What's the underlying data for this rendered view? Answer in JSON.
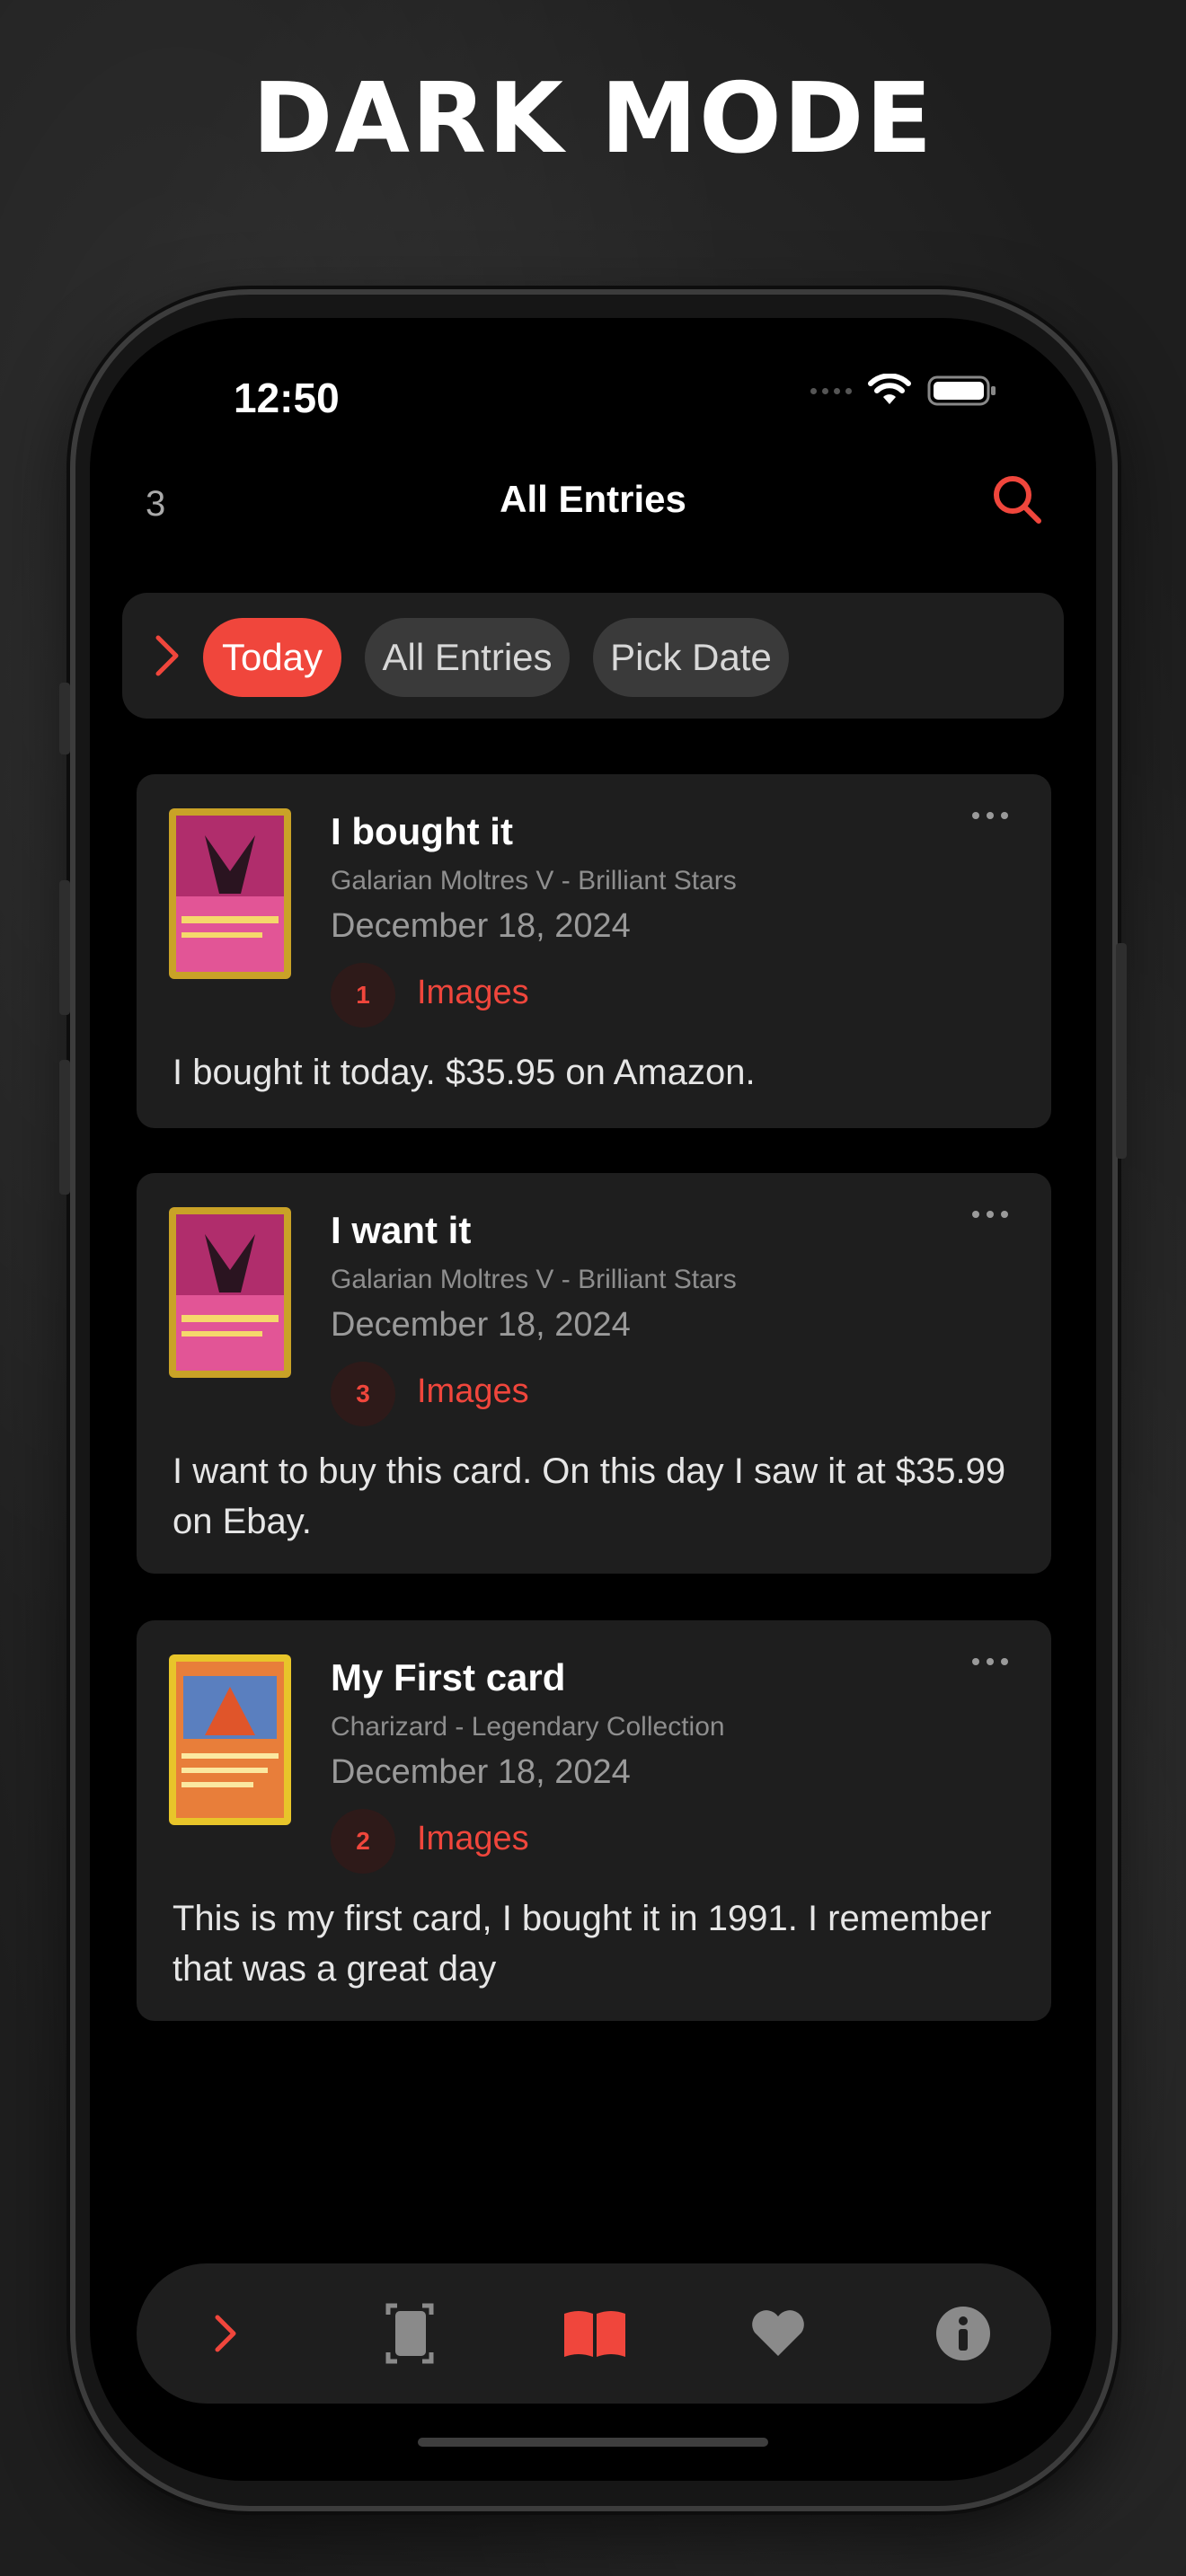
{
  "headline": "DARK MODE",
  "status_bar": {
    "time": "12:50"
  },
  "nav": {
    "count": "3",
    "title": "All Entries"
  },
  "filters": {
    "chips": [
      {
        "label": "Today"
      },
      {
        "label": "All Entries"
      },
      {
        "label": "Pick Date"
      }
    ]
  },
  "entries": [
    {
      "title": "I bought it",
      "subtitle": "Galarian Moltres V - Brilliant Stars",
      "date": "December 18, 2024",
      "image_count": "1",
      "images_label": "Images",
      "body": "I bought it today. $35.95 on Amazon."
    },
    {
      "title": "I want it",
      "subtitle": "Galarian Moltres V - Brilliant Stars",
      "date": "December 18, 2024",
      "image_count": "3",
      "images_label": "Images",
      "body": "I want to buy this card. On this day I saw it at $35.99 on Ebay."
    },
    {
      "title": "My First card",
      "subtitle": "Charizard - Legendary Collection",
      "date": "December 18, 2024",
      "image_count": "2",
      "images_label": "Images",
      "body": "This is my first card, I bought it in 1991. I remember that was a great day"
    }
  ],
  "tabbar": {
    "items": [
      {
        "icon": "chevron-right-icon"
      },
      {
        "icon": "card-scan-icon"
      },
      {
        "icon": "book-open-icon"
      },
      {
        "icon": "heart-icon"
      },
      {
        "icon": "info-icon"
      }
    ]
  },
  "colors": {
    "accent": "#f0463c",
    "card_bg": "#1e1e1e",
    "screen_bg": "#000000"
  }
}
